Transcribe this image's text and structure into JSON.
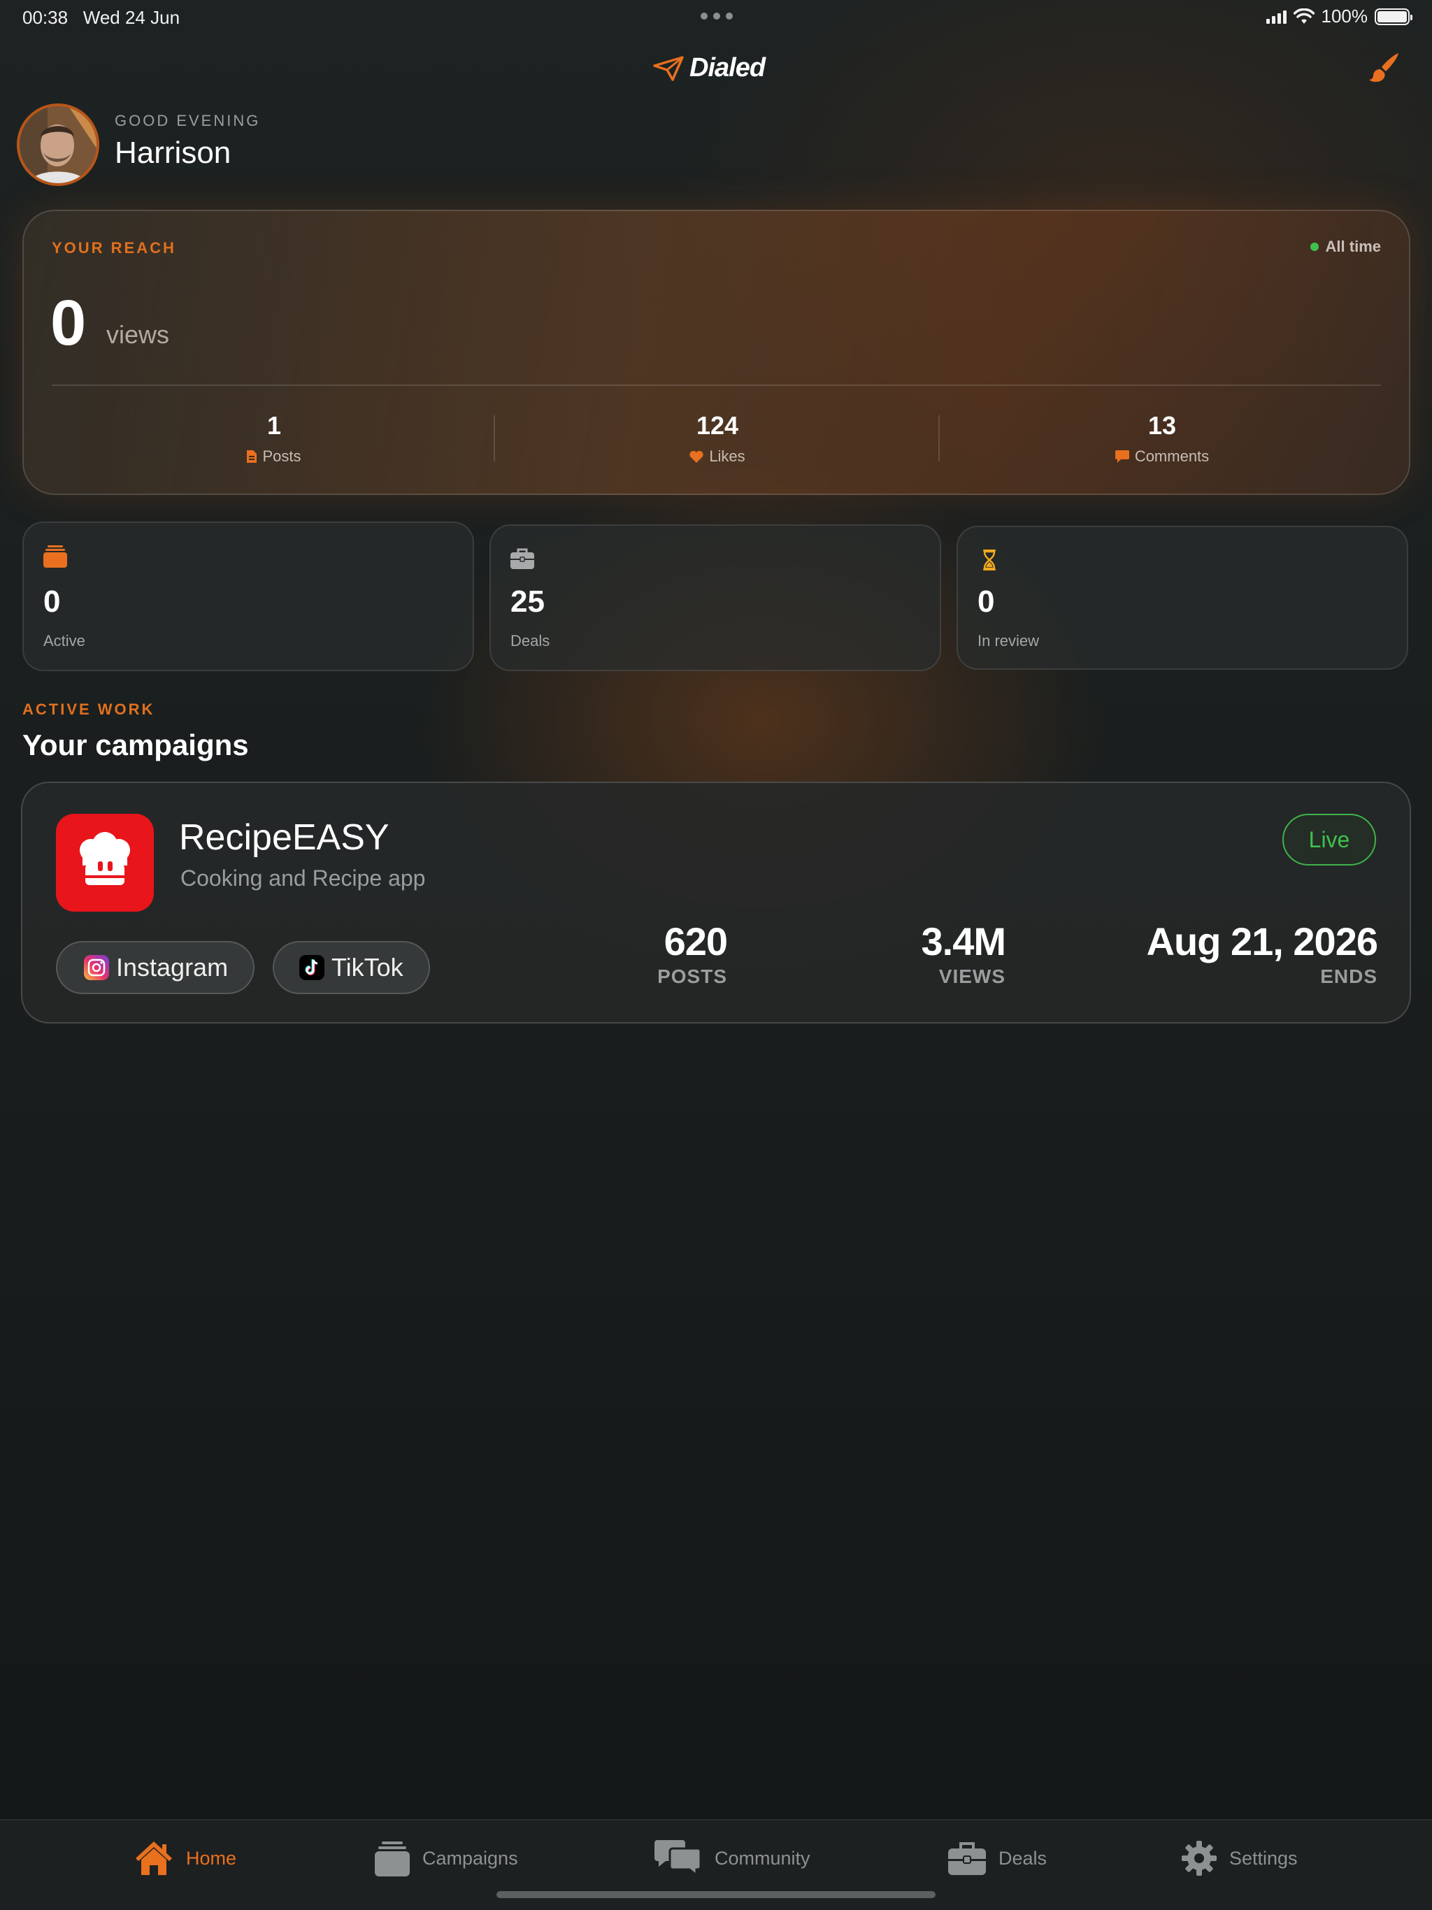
{
  "status_bar": {
    "time": "00:38",
    "date": "Wed 24 Jun",
    "battery": "100%"
  },
  "header": {
    "brand": "Dialed"
  },
  "greeting": {
    "label": "GOOD EVENING",
    "name": "Harrison"
  },
  "reach": {
    "label": "YOUR REACH",
    "period": "All time",
    "views": "0",
    "views_unit": "views",
    "stats": [
      {
        "value": "1",
        "label": "Posts",
        "icon": "document-icon"
      },
      {
        "value": "124",
        "label": "Likes",
        "icon": "heart-icon"
      },
      {
        "value": "13",
        "label": "Comments",
        "icon": "comment-icon"
      }
    ]
  },
  "mini_stats": [
    {
      "value": "0",
      "label": "Active",
      "icon": "stack-icon"
    },
    {
      "value": "25",
      "label": "Deals",
      "icon": "briefcase-icon"
    },
    {
      "value": "0",
      "label": "In review",
      "icon": "hourglass-icon"
    }
  ],
  "section": {
    "kicker": "ACTIVE WORK",
    "title": "Your campaigns"
  },
  "campaign": {
    "name": "RecipeEASY",
    "subtitle": "Cooking and Recipe app",
    "status": "Live",
    "platforms": [
      "Instagram",
      "TikTok"
    ],
    "stats": [
      {
        "value": "620",
        "label": "POSTS"
      },
      {
        "value": "3.4M",
        "label": "VIEWS"
      },
      {
        "value": "Aug 21, 2026",
        "label": "ENDS"
      }
    ]
  },
  "tabs": [
    {
      "label": "Home",
      "icon": "house-icon",
      "active": true
    },
    {
      "label": "Campaigns",
      "icon": "stack-icon",
      "active": false
    },
    {
      "label": "Community",
      "icon": "chat-bubbles-icon",
      "active": false
    },
    {
      "label": "Deals",
      "icon": "briefcase-icon",
      "active": false
    },
    {
      "label": "Settings",
      "icon": "gear-icon",
      "active": false
    }
  ],
  "colors": {
    "accent": "#e8701f",
    "live": "#3fc14d",
    "app_icon": "#e8151b"
  }
}
